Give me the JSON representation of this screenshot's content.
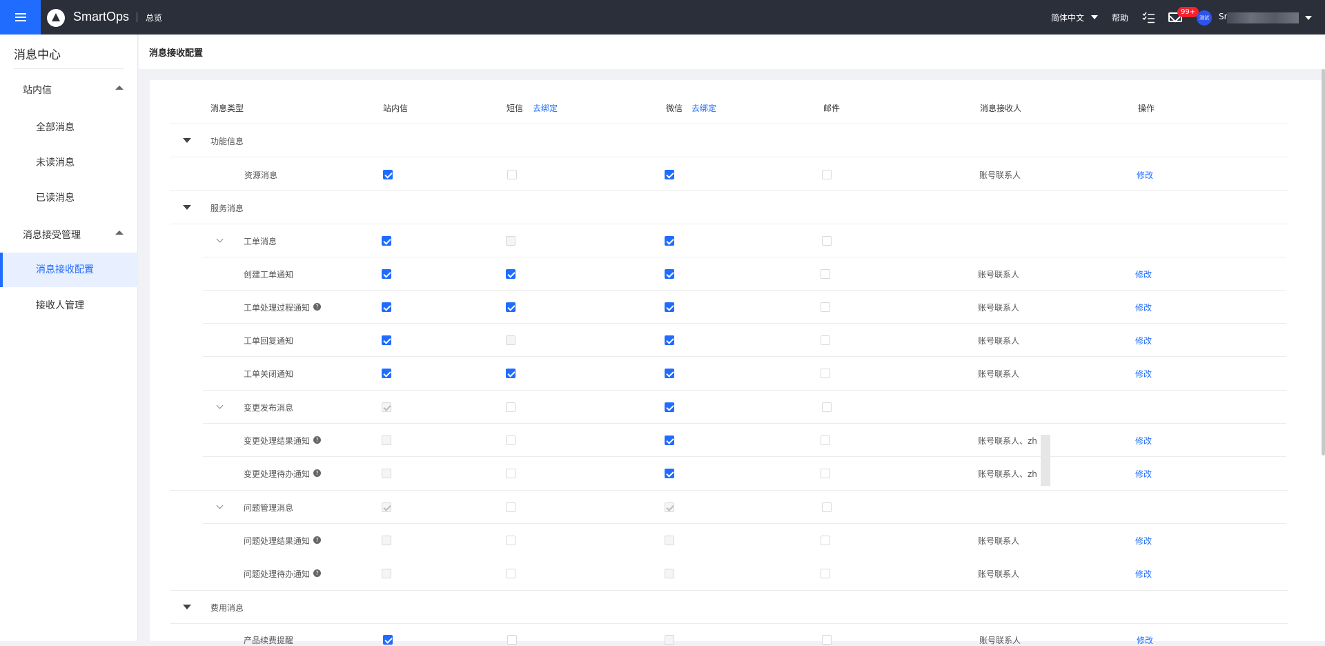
{
  "topbar": {
    "brand": "SmartOps",
    "overview": "总览",
    "language": "简体中文",
    "help": "帮助",
    "mail_badge": "99+",
    "avatar_text": "测试",
    "username": "Sn"
  },
  "sidebar": {
    "title": "消息中心",
    "groups": [
      {
        "label": "站内信",
        "items": [
          "全部消息",
          "未读消息",
          "已读消息"
        ]
      },
      {
        "label": "消息接受管理",
        "items": [
          "消息接收配置",
          "接收人管理"
        ]
      }
    ]
  },
  "page": {
    "title": "消息接收配置"
  },
  "table": {
    "columns": {
      "type": "消息类型",
      "inbox": "站内信",
      "sms": "短信",
      "sms_bind": "去绑定",
      "wechat": "微信",
      "wechat_bind": "去绑定",
      "email": "邮件",
      "receiver": "消息接收人",
      "action": "操作"
    },
    "edit_label": "修改",
    "categories": [
      "功能信息",
      "服务消息",
      "费用消息"
    ],
    "rows": [
      {
        "name": "资源消息",
        "inbox": true,
        "sms": false,
        "wechat": true,
        "email": false,
        "receiver": "账号联系人"
      },
      {
        "name": "工单消息",
        "inbox": true,
        "sms": false,
        "wechat": true,
        "email": false,
        "receiver": ""
      },
      {
        "name": "创建工单通知",
        "inbox": true,
        "sms": true,
        "wechat": true,
        "email": false,
        "receiver": "账号联系人"
      },
      {
        "name": "工单处理过程通知",
        "inbox": true,
        "sms": true,
        "wechat": true,
        "email": false,
        "receiver": "账号联系人"
      },
      {
        "name": "工单回复通知",
        "inbox": true,
        "sms": false,
        "wechat": true,
        "email": false,
        "receiver": "账号联系人"
      },
      {
        "name": "工单关闭通知",
        "inbox": true,
        "sms": true,
        "wechat": true,
        "email": false,
        "receiver": "账号联系人"
      },
      {
        "name": "变更发布消息",
        "inbox": true,
        "sms": false,
        "wechat": true,
        "email": false,
        "receiver": ""
      },
      {
        "name": "变更处理结果通知",
        "inbox": false,
        "sms": false,
        "wechat": true,
        "email": false,
        "receiver": "账号联系人、zh"
      },
      {
        "name": "变更处理待办通知",
        "inbox": false,
        "sms": false,
        "wechat": true,
        "email": false,
        "receiver": "账号联系人、zh"
      },
      {
        "name": "问题管理消息",
        "inbox": true,
        "sms": false,
        "wechat": true,
        "email": false,
        "receiver": ""
      },
      {
        "name": "问题处理结果通知",
        "inbox": false,
        "sms": false,
        "wechat": false,
        "email": false,
        "receiver": "账号联系人"
      },
      {
        "name": "问题处理待办通知",
        "inbox": false,
        "sms": false,
        "wechat": false,
        "email": false,
        "receiver": "账号联系人"
      },
      {
        "name": "产品续费提醒",
        "inbox": true,
        "sms": false,
        "wechat": false,
        "email": false,
        "receiver": "账号联系人"
      }
    ]
  },
  "colors": {
    "accent": "#1f6cff",
    "topbar": "#2b2f3a",
    "badge": "#f5222d"
  },
  "icons": [
    "menu-icon",
    "logo-icon",
    "tasks-icon",
    "mail-icon",
    "help-circle-icon",
    "caret-down-icon",
    "caret-up-icon",
    "chevron-down-icon"
  ]
}
